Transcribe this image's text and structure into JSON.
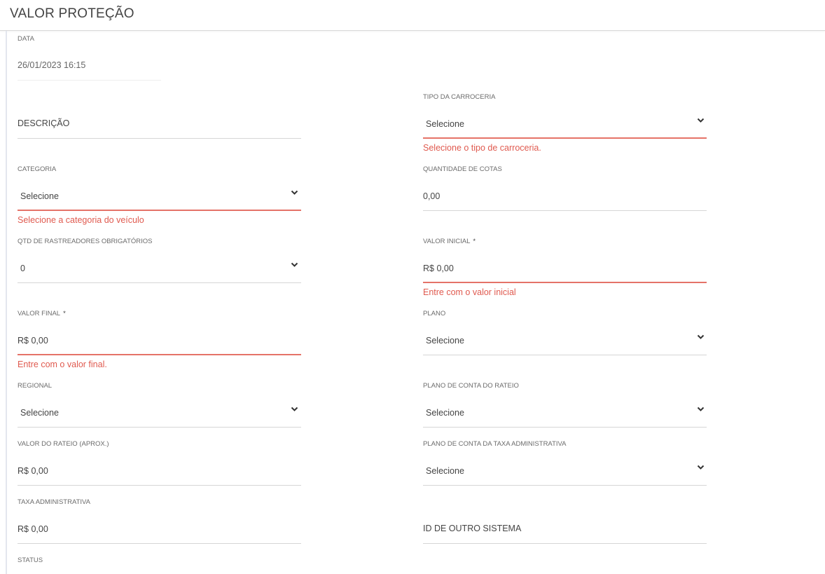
{
  "header": {
    "title": "VALOR PROTEÇÃO"
  },
  "fields": {
    "data": {
      "label": "DATA",
      "value": "26/01/2023 16:15"
    },
    "descricao": {
      "placeholder": "DESCRIÇÃO"
    },
    "tipo_carroceria": {
      "label": "TIPO DA CARROCERIA",
      "value": "Selecione",
      "error": "Selecione o tipo de carroceria."
    },
    "categoria": {
      "label": "CATEGORIA",
      "value": "Selecione",
      "error": "Selecione a categoria do veículo"
    },
    "quantidade_cotas": {
      "label": "QUANTIDADE DE COTAS",
      "value": "0,00"
    },
    "qtd_rastreadores": {
      "label": "QTD DE RASTREADORES OBRIGATÓRIOS",
      "value": "0"
    },
    "valor_inicial": {
      "label": "VALOR INICIAL",
      "required": "*",
      "value": "R$ 0,00",
      "error": "Entre com o valor inicial"
    },
    "valor_final": {
      "label": "VALOR FINAL",
      "required": "*",
      "value": "R$ 0,00",
      "error": "Entre com o valor final."
    },
    "plano": {
      "label": "PLANO",
      "value": "Selecione"
    },
    "regional": {
      "label": "REGIONAL",
      "value": "Selecione"
    },
    "plano_conta_rateio": {
      "label": "PLANO DE CONTA DO RATEIO",
      "value": "Selecione"
    },
    "valor_rateio": {
      "label": "VALOR DO RATEIO (APROX.)",
      "value": "R$ 0,00"
    },
    "plano_conta_taxa": {
      "label": "PLANO DE CONTA DA TAXA ADMINISTRATIVA",
      "value": "Selecione"
    },
    "taxa_administrativa": {
      "label": "TAXA ADMINISTRATIVA",
      "value": "R$ 0,00"
    },
    "id_outro_sistema": {
      "placeholder": "ID DE OUTRO SISTEMA"
    },
    "status": {
      "label": "STATUS"
    }
  },
  "colors": {
    "error": "#e05a4f",
    "error_line": "#e57368",
    "line": "#d6d6d6"
  },
  "icons": {
    "dropdown": "chevron-down-icon"
  }
}
